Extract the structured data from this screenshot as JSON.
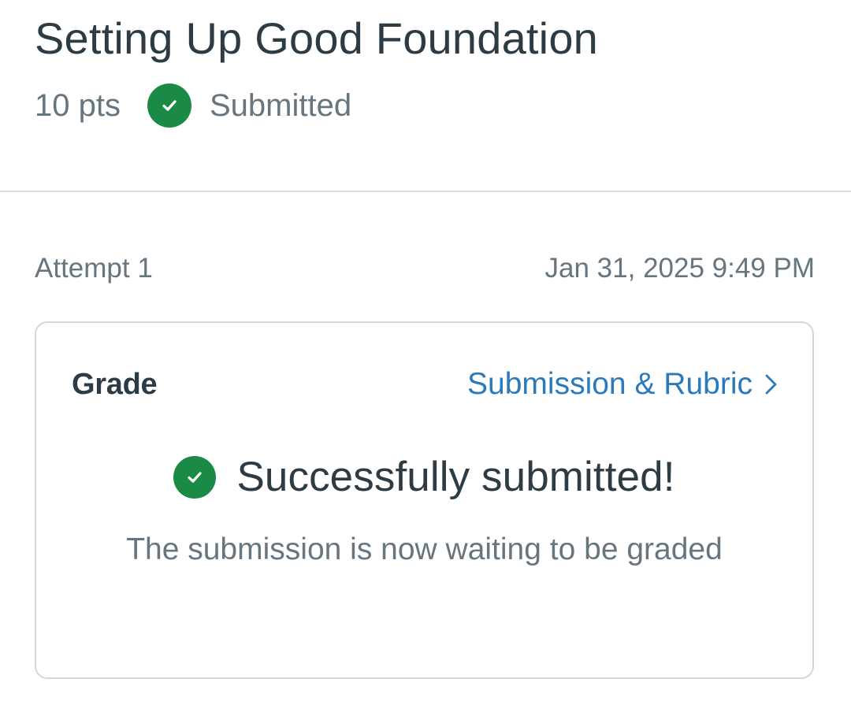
{
  "assignment": {
    "title": "Setting Up Good Foundation",
    "points": "10 pts",
    "status": "Submitted",
    "status_icon": "check-circle-icon",
    "status_color": "#1b8a46"
  },
  "attempt": {
    "label": "Attempt 1",
    "submitted_at": "Jan 31, 2025 9:49 PM"
  },
  "grade_card": {
    "label": "Grade",
    "link_label": "Submission & Rubric",
    "link_icon": "chevron-right-icon",
    "success_title": "Successfully submitted!",
    "success_message": "The submission is now waiting to be graded",
    "success_icon": "check-circle-icon",
    "link_color": "#2b7abc"
  }
}
